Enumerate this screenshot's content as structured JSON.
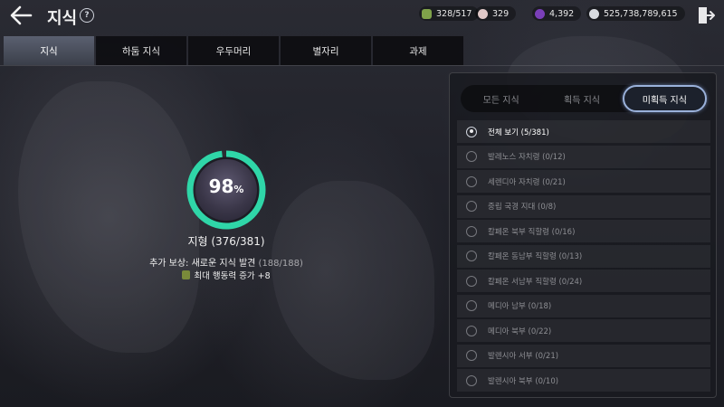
{
  "header": {
    "title": "지식",
    "help_icon": "map-book-icon",
    "resources": [
      {
        "icon": "energy-icon",
        "color": "#7fa24a",
        "value": "328/517"
      },
      {
        "icon": "pearl-icon",
        "color": "#e0c8c8",
        "value": "329"
      },
      {
        "icon": "purple-gem-icon",
        "color": "#7a3fb8",
        "value": "4,392"
      },
      {
        "icon": "silver-coin-icon",
        "color": "#d8dbe0",
        "value": "525,738,789,615"
      }
    ]
  },
  "tabs": [
    {
      "label": "지식",
      "active": true
    },
    {
      "label": "하둠 지식",
      "active": false
    },
    {
      "label": "우두머리",
      "active": false
    },
    {
      "label": "별자리",
      "active": false
    },
    {
      "label": "과제",
      "active": false
    }
  ],
  "progress": {
    "percent": 98,
    "percent_value": "98",
    "percent_unit": "%",
    "category_label": "지형 (376/381)",
    "reward_prefix": "추가 보상: 새로운 지식 발견 ",
    "reward_count": "(188/188)",
    "reward_effect": "최대 행동력 증가 +8",
    "ring_color": "#2fd6a8"
  },
  "filters": [
    {
      "label": "모든 지식",
      "active": false
    },
    {
      "label": "획득 지식",
      "active": false
    },
    {
      "label": "미획득 지식",
      "active": true
    }
  ],
  "regions": [
    {
      "label": "전체 보기 (5/381)",
      "selected": true
    },
    {
      "label": "발레노스 자치령 (0/12)",
      "selected": false
    },
    {
      "label": "세렌디아 자치령 (0/21)",
      "selected": false
    },
    {
      "label": "중립 국경 지대 (0/8)",
      "selected": false
    },
    {
      "label": "칼페온 북부 직할령 (0/16)",
      "selected": false
    },
    {
      "label": "칼페온 동남부 직할령 (0/13)",
      "selected": false
    },
    {
      "label": "칼페온 서남부 직할령 (0/24)",
      "selected": false
    },
    {
      "label": "메디아 남부 (0/18)",
      "selected": false
    },
    {
      "label": "메디아 북부 (0/22)",
      "selected": false
    },
    {
      "label": "발렌시아 서부 (0/21)",
      "selected": false
    },
    {
      "label": "발렌시아 북부 (0/10)",
      "selected": false
    }
  ]
}
